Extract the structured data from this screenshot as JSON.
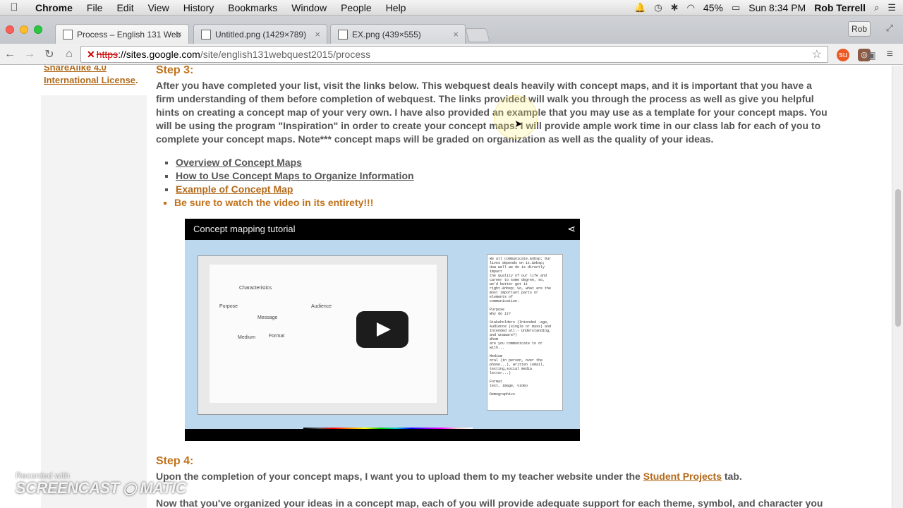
{
  "menubar": {
    "app": "Chrome",
    "items": [
      "File",
      "Edit",
      "View",
      "History",
      "Bookmarks",
      "Window",
      "People",
      "Help"
    ],
    "battery": "45%",
    "clock": "Sun 8:34 PM",
    "user": "Rob Terrell"
  },
  "tabs": [
    {
      "title": "Process – English 131 Web",
      "active": true
    },
    {
      "title": "Untitled.png (1429×789)",
      "active": false
    },
    {
      "title": "EX.png (439×555)",
      "active": false
    }
  ],
  "profile": "Rob",
  "address": {
    "scheme": "https",
    "host": "://sites.google.com",
    "path": "/site/english131webquest2015/process"
  },
  "sidebar": {
    "license_line1": "ShareAlike 4.0",
    "license_line2": "International License",
    "license_tail": "."
  },
  "step3": {
    "heading": "Step 3:",
    "paragraph": "After you have completed your list, visit the links below.  This webquest deals heavily with concept maps, and it is important that you have a firm understanding of them before completion of webquest.  The links provided will walk you through the process as well as give you helpful hints on creating a concept map of your very own.  I have also provided an example that you may use as a template for your concept maps.  You will be using the program \"Inspiration\" in order to create your concept maps.  I will provide ample work time in our class lab for each of you to complete your concept maps.  Note*** concept maps will be graded on organization as well as the quality of your ideas.",
    "links": [
      "Overview of Concept Maps",
      "How to Use Concept Maps to Organize Information",
      "Example of Concept Map"
    ],
    "note": "Be sure to watch the video in its entirety!!!"
  },
  "video": {
    "title": "Concept mapping tutorial",
    "nodes": [
      "Characteristics",
      "Purpose",
      "Audience",
      "Message",
      "Format",
      "Medium"
    ],
    "notes_text": "We all communicate.&nbsp; Our\nlives depends on it.&nbsp;\nHow well we do is directly\nimpact\nthe quality of our life and\ncareer to some degree, so,\nwe'd better get it\nright.&nbsp; So, what are the\nmost important parts or\nelements of\ncommunication.\n\nPurpose\nWhy do it?\n\nStakeholders (Intended -age,\nAudience (single or mass) and\nIntended all:- Understanding,\nand unaware?)\nWhom\nare you communicate to or\nwith...\n\nMedium\noral (in person, over the\nphone...), written (email,\ntexting,social media\nletter...)\n\nFormat\ntext, image, video\n\nDemographics"
  },
  "step4": {
    "heading": "Step 4:",
    "sentence_before": "Upon the completion of your concept maps, I want you to upload them to my teacher website under the",
    "link": "Student Projects",
    "sentence_after": "tab.",
    "next_sentence": "Now that you've organized your ideas in a concept map, each of you will provide adequate support for each theme, symbol, and character you"
  },
  "watermark": {
    "line1": "Recorded with",
    "line2": "SCREENCAST ◉ MATIC"
  }
}
